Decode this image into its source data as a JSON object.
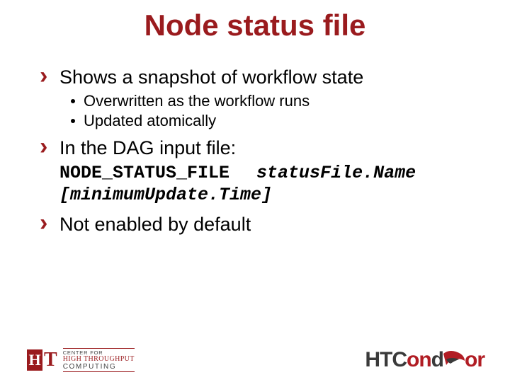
{
  "title": "Node status file",
  "bullets": {
    "b1": {
      "text": "Shows a snapshot of workflow state",
      "sub": [
        "Overwritten as the workflow runs",
        "Updated atomically"
      ]
    },
    "b2": {
      "text": "In the DAG input file:",
      "code": {
        "keyword": "NODE_STATUS_FILE",
        "arg": "statusFile.Name",
        "optional": "[minimumUpdate.Time]"
      }
    },
    "b3": {
      "text": "Not enabled by default"
    }
  },
  "footer": {
    "left_logo": {
      "mark_h": "H",
      "mark_t": "T",
      "line1": "CENTER FOR",
      "line2": "HIGH THROUGHPUT",
      "line3": "COMPUTING"
    },
    "right_logo": {
      "part1": "HTC",
      "part2": "on",
      "part3": "d",
      "part4": "or"
    }
  }
}
